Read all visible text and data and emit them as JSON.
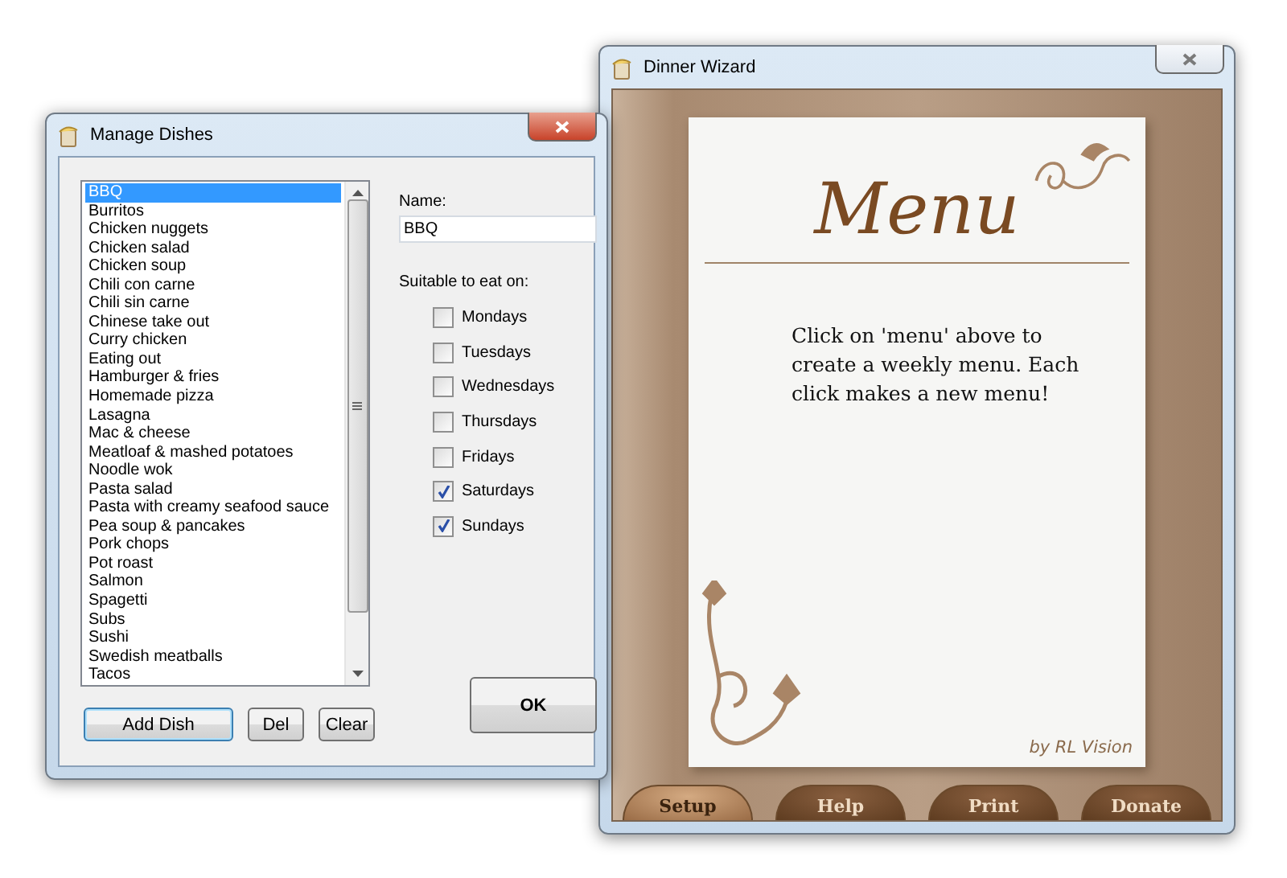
{
  "dinner_wizard": {
    "title": "Dinner Wizard",
    "menu_card": {
      "heading": "Menu",
      "message": "Click on 'menu' above to create a weekly menu. Each click makes a new menu!",
      "credit": "by RL Vision"
    },
    "tabs": [
      {
        "label": "Setup",
        "selected": true
      },
      {
        "label": "Help",
        "selected": false
      },
      {
        "label": "Print",
        "selected": false
      },
      {
        "label": "Donate",
        "selected": false
      }
    ]
  },
  "manage_dishes": {
    "title": "Manage Dishes",
    "dishes": [
      {
        "label": "BBQ",
        "selected": true
      },
      {
        "label": "Burritos",
        "selected": false
      },
      {
        "label": "Chicken nuggets",
        "selected": false
      },
      {
        "label": "Chicken salad",
        "selected": false
      },
      {
        "label": "Chicken soup",
        "selected": false
      },
      {
        "label": "Chili con carne",
        "selected": false
      },
      {
        "label": "Chili sin carne",
        "selected": false
      },
      {
        "label": "Chinese take out",
        "selected": false
      },
      {
        "label": "Curry chicken",
        "selected": false
      },
      {
        "label": "Eating out",
        "selected": false
      },
      {
        "label": "Hamburger & fries",
        "selected": false
      },
      {
        "label": "Homemade pizza",
        "selected": false
      },
      {
        "label": "Lasagna",
        "selected": false
      },
      {
        "label": "Mac & cheese",
        "selected": false
      },
      {
        "label": "Meatloaf & mashed potatoes",
        "selected": false
      },
      {
        "label": "Noodle wok",
        "selected": false
      },
      {
        "label": "Pasta salad",
        "selected": false
      },
      {
        "label": "Pasta with creamy seafood sauce",
        "selected": false
      },
      {
        "label": "Pea soup & pancakes",
        "selected": false
      },
      {
        "label": "Pork chops",
        "selected": false
      },
      {
        "label": "Pot roast",
        "selected": false
      },
      {
        "label": "Salmon",
        "selected": false
      },
      {
        "label": "Spagetti",
        "selected": false
      },
      {
        "label": "Subs",
        "selected": false
      },
      {
        "label": "Sushi",
        "selected": false
      },
      {
        "label": "Swedish meatballs",
        "selected": false
      },
      {
        "label": "Tacos",
        "selected": false
      }
    ],
    "name_label": "Name:",
    "name_value": "BBQ",
    "days_label": "Suitable to eat on:",
    "days": [
      {
        "label": "Mondays",
        "checked": false
      },
      {
        "label": "Tuesdays",
        "checked": false
      },
      {
        "label": "Wednesdays",
        "checked": false
      },
      {
        "label": "Thursdays",
        "checked": false
      },
      {
        "label": "Fridays",
        "checked": false
      },
      {
        "label": "Saturdays",
        "checked": true
      },
      {
        "label": "Sundays",
        "checked": true
      }
    ],
    "buttons": {
      "add": "Add Dish",
      "delete": "Del",
      "clear": "Clear",
      "ok": "OK"
    }
  }
}
